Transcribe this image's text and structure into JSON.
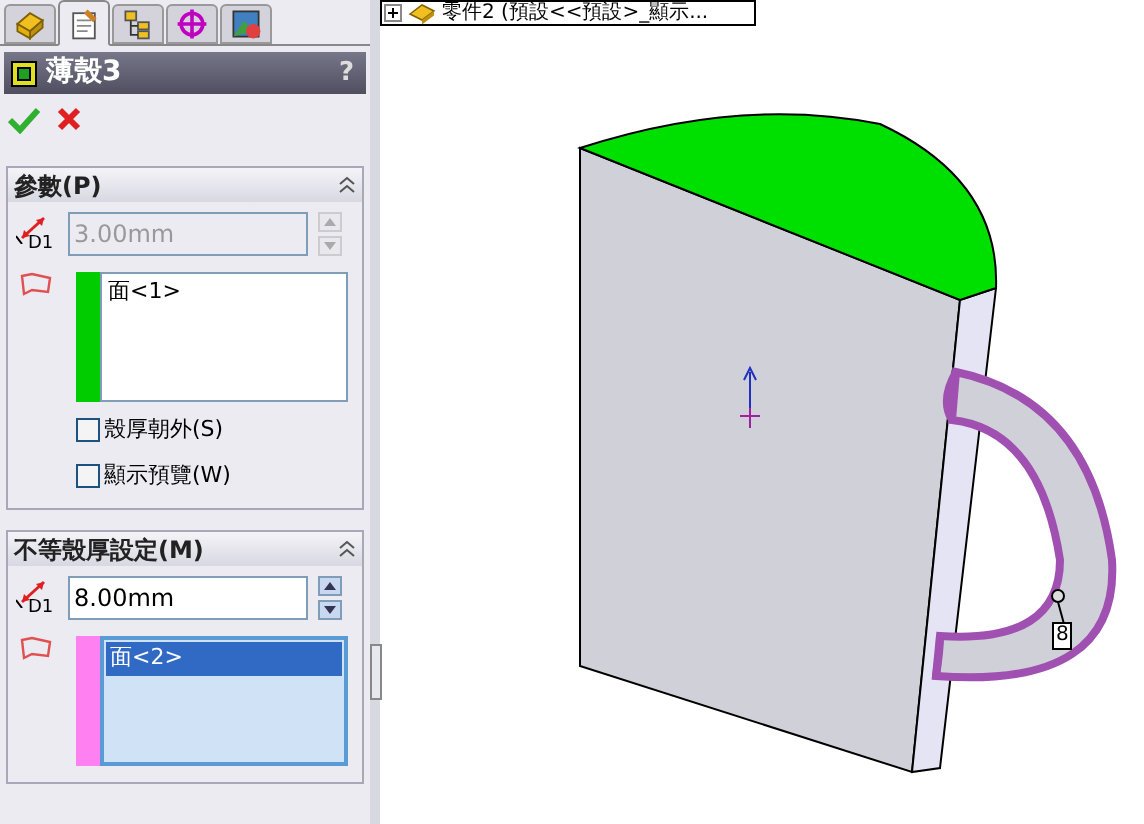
{
  "tabs": [
    {
      "selected": false
    },
    {
      "selected": true
    },
    {
      "selected": false
    },
    {
      "selected": false
    },
    {
      "selected": false
    }
  ],
  "feature": {
    "title": "薄殼3",
    "help": "?"
  },
  "groups": [
    {
      "title": "參數(P)",
      "dimension_label": "D1",
      "thickness": "3.00mm",
      "thickness_disabled": true,
      "color": "#00cc00",
      "faces": [
        {
          "label": "面<1>",
          "selected": false
        }
      ],
      "options": [
        {
          "label": "殼厚朝外(S)",
          "checked": false
        },
        {
          "label": "顯示預覽(W)",
          "checked": false
        }
      ]
    },
    {
      "title": "不等殼厚設定(M)",
      "dimension_label": "D1",
      "thickness": "8.00mm",
      "thickness_disabled": false,
      "color": "#ff80f0",
      "faces": [
        {
          "label": "面<2>",
          "selected": true
        }
      ]
    }
  ],
  "tree_item": "零件2 (預設<<預設>_顯示...",
  "callout_label": "8"
}
